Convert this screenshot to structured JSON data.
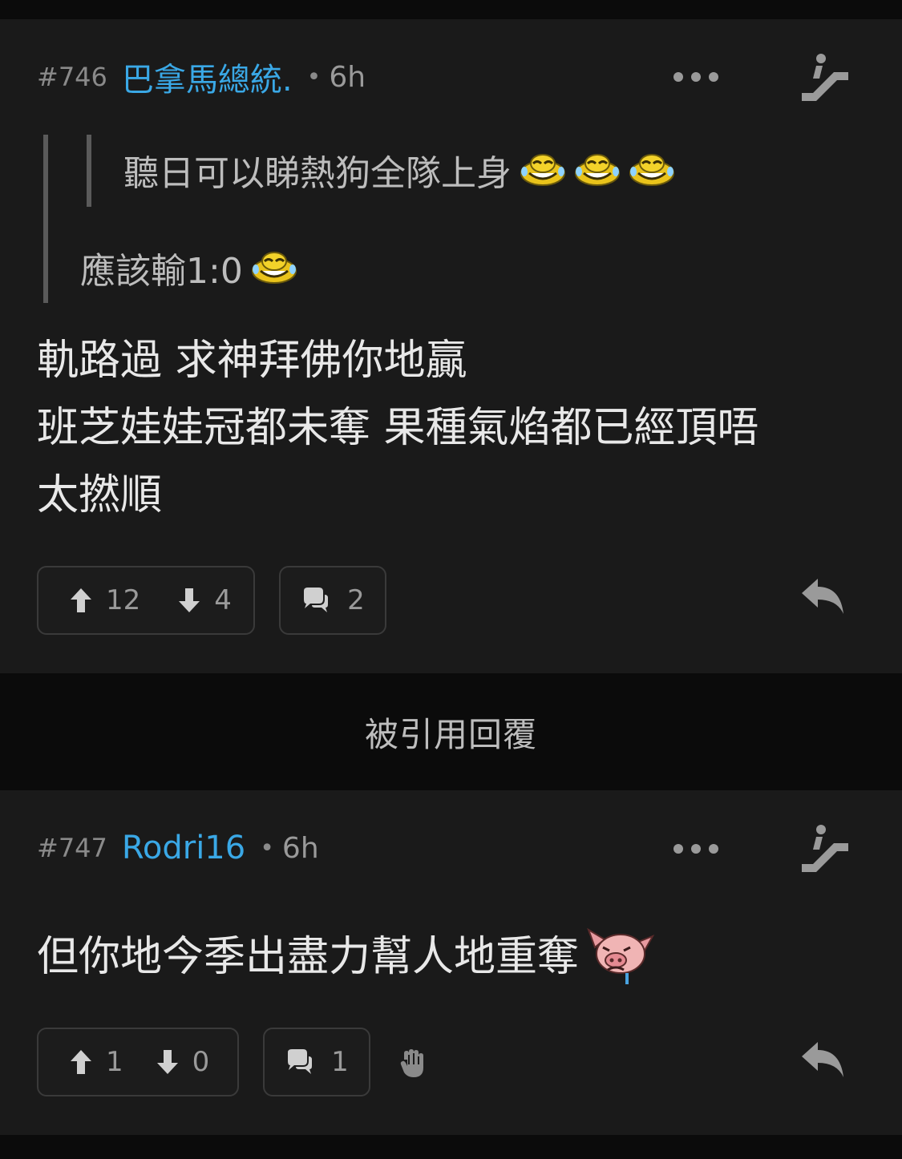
{
  "posts": [
    {
      "number": "#746",
      "username": "巴拿馬總統.",
      "separator": "•",
      "time": "6h",
      "quotes": {
        "nested_text": "聽日可以睇熱狗全隊上身",
        "nested_emojis": [
          "laughing-emoji",
          "laughing-emoji",
          "laughing-emoji"
        ],
        "outer_text": "應該輸1:0",
        "outer_emojis": [
          "laughing-emoji"
        ]
      },
      "body_lines": [
        "軌路過 求神拜佛你地贏",
        "班芝娃娃冠都未奪 果種氣焰都已經頂唔",
        "太撚順"
      ],
      "upvotes": "12",
      "downvotes": "4",
      "comments": "2"
    },
    {
      "number": "#747",
      "username": "Rodri16",
      "separator": "•",
      "time": "6h",
      "body_lines": [
        "但你地今季出盡力幫人地重奪"
      ],
      "body_emoji": "crying-pig-emoji",
      "upvotes": "1",
      "downvotes": "0",
      "comments": "1"
    }
  ],
  "divider": {
    "label": "被引用回覆"
  },
  "colors": {
    "accent": "#3aa8e6",
    "background": "#1a1a1a",
    "page": "#0b0b0b"
  }
}
